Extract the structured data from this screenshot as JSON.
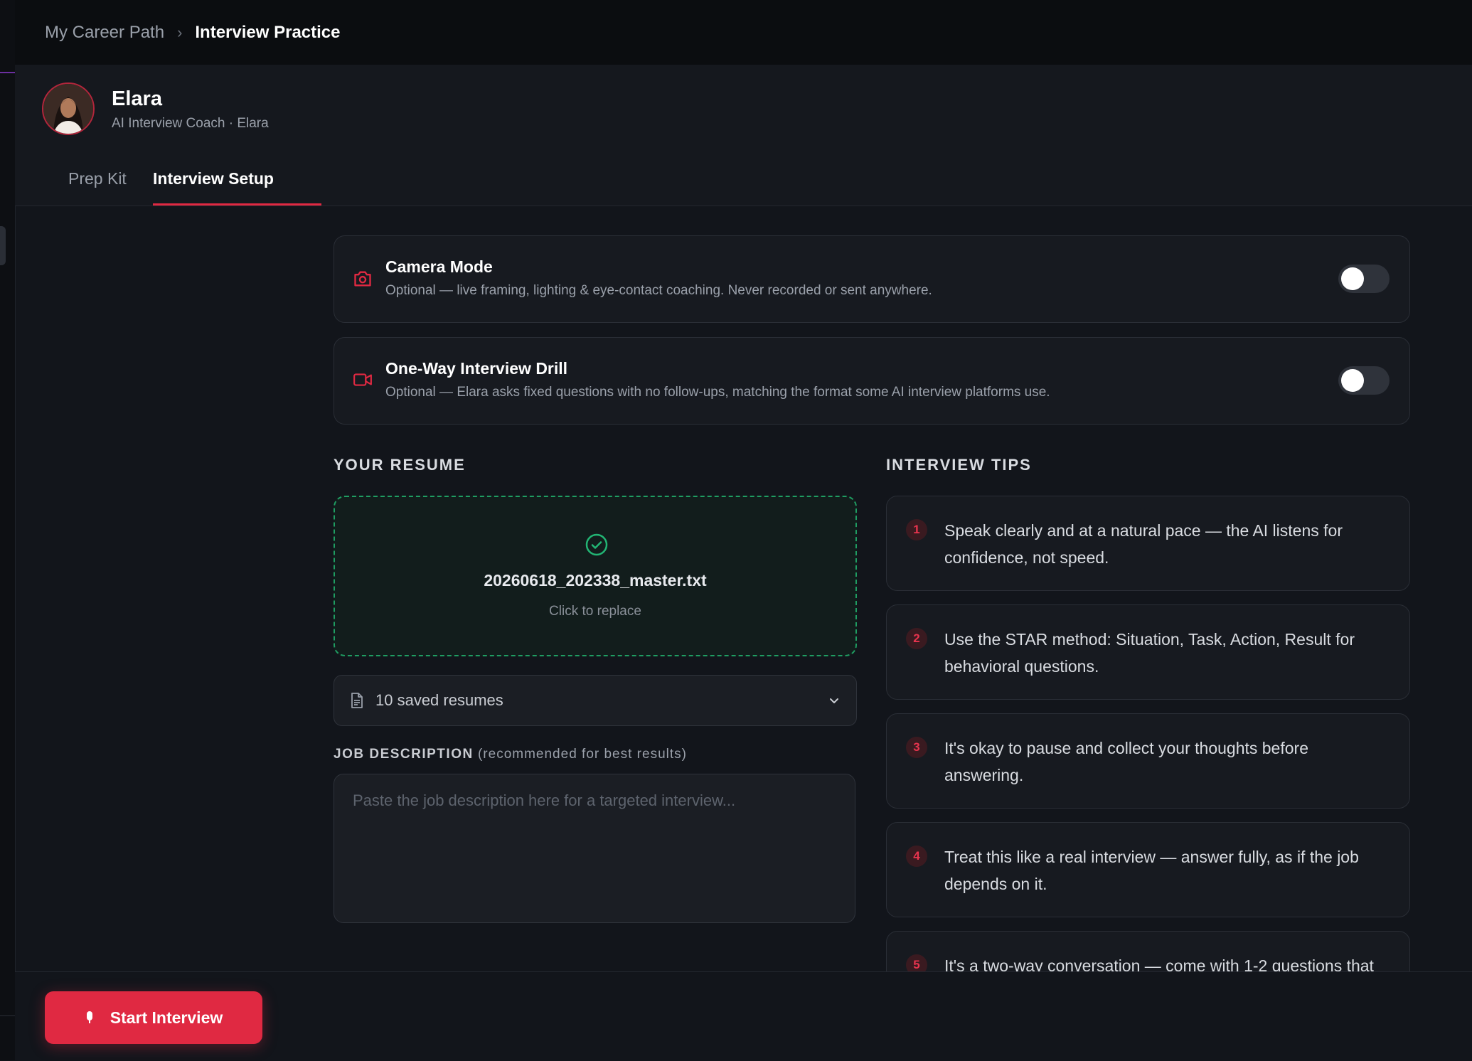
{
  "breadcrumb": {
    "parent": "My Career Path",
    "separator": "›",
    "current": "Interview Practice"
  },
  "coach": {
    "name": "Elara",
    "subtitle": "AI Interview Coach · Elara"
  },
  "tabs": [
    {
      "label": "Prep Kit",
      "active": false
    },
    {
      "label": "Interview Setup",
      "active": true
    }
  ],
  "options": [
    {
      "icon": "camera-icon",
      "title": "Camera Mode",
      "description": "Optional — live framing, lighting & eye-contact coaching. Never recorded or sent anywhere.",
      "enabled": false
    },
    {
      "icon": "video-icon",
      "title": "One-Way Interview Drill",
      "description": "Optional — Elara asks fixed questions with no follow-ups, matching the format some AI interview platforms use.",
      "enabled": false
    }
  ],
  "resume": {
    "section_title": "YOUR RESUME",
    "file_name": "20260618_202338_master.txt",
    "replace_hint": "Click to replace",
    "saved_resumes_label": "10 saved resumes"
  },
  "job_description": {
    "label": "JOB DESCRIPTION",
    "label_note": "(recommended for best results)",
    "placeholder": "Paste the job description here for a targeted interview..."
  },
  "tips": {
    "section_title": "INTERVIEW TIPS",
    "items": [
      {
        "number": "1",
        "text": "Speak clearly and at a natural pace — the AI listens for confidence, not speed."
      },
      {
        "number": "2",
        "text": "Use the STAR method: Situation, Task, Action, Result for behavioral questions."
      },
      {
        "number": "3",
        "text": "It's okay to pause and collect your thoughts before answering."
      },
      {
        "number": "4",
        "text": "Treat this like a real interview — answer fully, as if the job depends on it."
      },
      {
        "number": "5",
        "text": "It's a two-way conversation — come with 1-2 questions that"
      }
    ]
  },
  "actions": {
    "start_label": "Start Interview"
  },
  "colors": {
    "accent": "#e02942",
    "success": "#1f9d62",
    "background": "#12151b"
  }
}
